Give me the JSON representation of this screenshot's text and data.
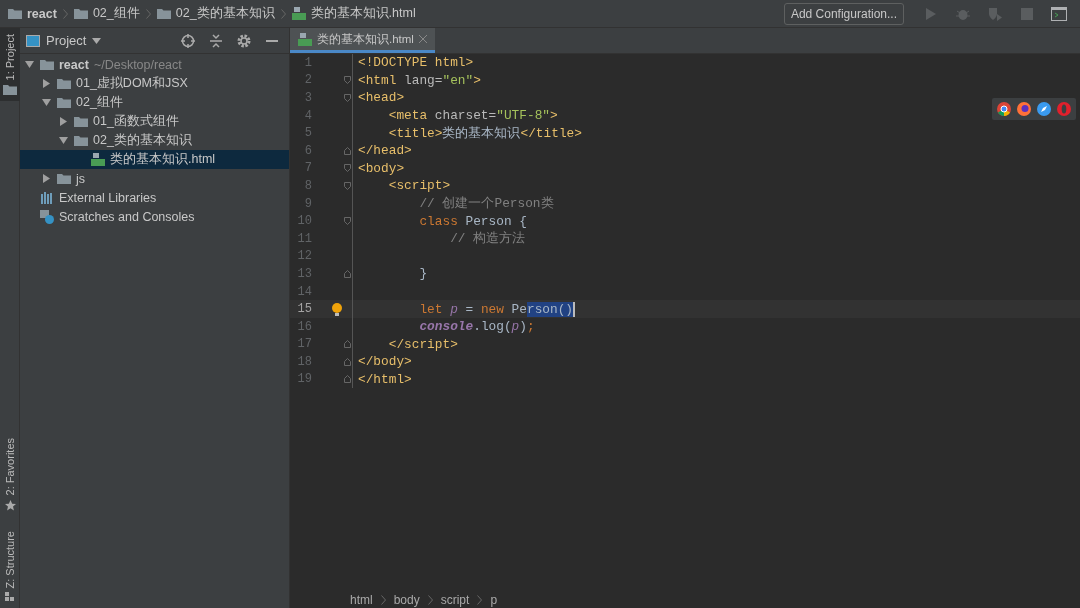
{
  "navbar": {
    "crumbs": [
      {
        "label": "react",
        "kind": "folder",
        "bold": true
      },
      {
        "label": "02_组件",
        "kind": "folder",
        "bold": false
      },
      {
        "label": "02_类的基本知识",
        "kind": "folder",
        "bold": false
      },
      {
        "label": "类的基本知识.html",
        "kind": "html",
        "bold": false
      }
    ],
    "config_button": "Add Configuration...",
    "run_actions": [
      {
        "kind": "run",
        "disabled": true
      },
      {
        "kind": "debug",
        "disabled": true
      },
      {
        "kind": "coverage",
        "disabled": true
      },
      {
        "kind": "stop",
        "disabled": true
      },
      {
        "kind": "terminal",
        "disabled": false
      }
    ]
  },
  "side_strip": {
    "top": [
      {
        "label": "1: Project",
        "kind": "folder",
        "selected": true
      }
    ],
    "bottom": [
      {
        "label": "2: Favorites",
        "kind": "star",
        "selected": false
      },
      {
        "label": "Z: Structure",
        "kind": "structure",
        "selected": false
      }
    ]
  },
  "project": {
    "title": "Project",
    "tree": [
      {
        "label": "react",
        "hint": "~/Desktop/react",
        "kind": "folder",
        "bold": true,
        "expanded": true,
        "selected": false,
        "children": [
          {
            "label": "01_虚拟DOM和JSX",
            "kind": "folder",
            "expanded": false,
            "selected": false
          },
          {
            "label": "02_组件",
            "kind": "folder",
            "expanded": true,
            "selected": false,
            "children": [
              {
                "label": "01_函数式组件",
                "kind": "folder",
                "expanded": false,
                "selected": false
              },
              {
                "label": "02_类的基本知识",
                "kind": "folder",
                "expanded": true,
                "selected": false,
                "children": [
                  {
                    "label": "类的基本知识.html",
                    "kind": "html",
                    "selected": true
                  }
                ]
              }
            ]
          },
          {
            "label": "js",
            "kind": "folder",
            "expanded": false,
            "selected": false
          }
        ]
      },
      {
        "label": "External Libraries",
        "kind": "libraries",
        "selected": false
      },
      {
        "label": "Scratches and Consoles",
        "kind": "scratches",
        "selected": false
      }
    ]
  },
  "editor": {
    "tabs": [
      {
        "label": "类的基本知识.html",
        "selected": true
      }
    ],
    "lines": [
      {
        "number": "1",
        "current": false,
        "fold_start": false,
        "fold_end": false,
        "tokens": [
          {
            "kind": "tag",
            "text": "<!DOCTYPE html>"
          }
        ]
      },
      {
        "number": "2",
        "current": false,
        "fold_start": true,
        "fold_end": false,
        "tokens": [
          {
            "kind": "tag",
            "text": "<html "
          },
          {
            "kind": "attr",
            "text": "lang="
          },
          {
            "kind": "str",
            "text": "\"en\""
          },
          {
            "kind": "tag",
            "text": ">"
          }
        ]
      },
      {
        "number": "3",
        "current": false,
        "fold_start": true,
        "fold_end": false,
        "tokens": [
          {
            "kind": "tag",
            "text": "<head>"
          }
        ]
      },
      {
        "number": "4",
        "current": false,
        "fold_start": false,
        "fold_end": false,
        "tokens": [
          {
            "kind": "tag",
            "text": "    <meta "
          },
          {
            "kind": "attr",
            "text": "charset="
          },
          {
            "kind": "str",
            "text": "\"UTF-8\""
          },
          {
            "kind": "tag",
            "text": ">"
          }
        ]
      },
      {
        "number": "5",
        "current": false,
        "fold_start": false,
        "fold_end": false,
        "tokens": [
          {
            "kind": "tag",
            "text": "    <title>"
          },
          {
            "kind": "plain",
            "text": "类的基本知识"
          },
          {
            "kind": "tag",
            "text": "</title>"
          }
        ]
      },
      {
        "number": "6",
        "current": false,
        "fold_start": false,
        "fold_end": true,
        "tokens": [
          {
            "kind": "tag",
            "text": "</head>"
          }
        ]
      },
      {
        "number": "7",
        "current": false,
        "fold_start": true,
        "fold_end": false,
        "tokens": [
          {
            "kind": "tag",
            "text": "<body>"
          }
        ]
      },
      {
        "number": "8",
        "current": false,
        "fold_start": true,
        "fold_end": false,
        "tokens": [
          {
            "kind": "tag",
            "text": "    <script>"
          }
        ]
      },
      {
        "number": "9",
        "current": false,
        "fold_start": false,
        "fold_end": false,
        "tokens": [
          {
            "kind": "comment",
            "text": "        // 创建一个Person类"
          }
        ]
      },
      {
        "number": "10",
        "current": false,
        "fold_start": true,
        "fold_end": false,
        "tokens": [
          {
            "kind": "keyword",
            "text": "        class "
          },
          {
            "kind": "plain",
            "text": "Person {"
          }
        ]
      },
      {
        "number": "11",
        "current": false,
        "fold_start": false,
        "fold_end": false,
        "tokens": [
          {
            "kind": "comment",
            "text": "            // 构造方法"
          }
        ]
      },
      {
        "number": "12",
        "current": false,
        "fold_start": false,
        "fold_end": false
      },
      {
        "number": "13",
        "current": false,
        "fold_start": false,
        "fold_end": true,
        "tokens": [
          {
            "kind": "plain",
            "text": "        }"
          }
        ]
      },
      {
        "number": "14",
        "current": false,
        "fold_start": false,
        "fold_end": false
      },
      {
        "number": "15",
        "current": true,
        "fold_start": false,
        "fold_end": false,
        "bulb": true,
        "tokens": [
          {
            "kind": "keyword",
            "text": "        let "
          },
          {
            "kind": "var",
            "text": "p"
          },
          {
            "kind": "plain",
            "text": " = "
          },
          {
            "kind": "keyword",
            "text": "new "
          },
          {
            "kind": "plain",
            "text": "Pe"
          },
          {
            "kind": "selection",
            "text": "rson()"
          }
        ]
      },
      {
        "number": "16",
        "current": false,
        "fold_start": false,
        "fold_end": false,
        "tokens": [
          {
            "kind": "call",
            "text": "        console"
          },
          {
            "kind": "plain",
            "text": ".log("
          },
          {
            "kind": "var",
            "text": "p"
          },
          {
            "kind": "plain",
            "text": ")"
          },
          {
            "kind": "keyword",
            "text": ";"
          }
        ]
      },
      {
        "number": "17",
        "current": false,
        "fold_start": false,
        "fold_end": true,
        "tokens": [
          {
            "kind": "tag",
            "text": "    </script>"
          }
        ]
      },
      {
        "number": "18",
        "current": false,
        "fold_start": false,
        "fold_end": true,
        "tokens": [
          {
            "kind": "tag",
            "text": "</body>"
          }
        ]
      },
      {
        "number": "19",
        "current": false,
        "fold_start": false,
        "fold_end": true,
        "tokens": [
          {
            "kind": "tag",
            "text": "</html>"
          }
        ]
      }
    ],
    "browsers": [
      {
        "kind": "chrome"
      },
      {
        "kind": "firefox"
      },
      {
        "kind": "safari"
      },
      {
        "kind": "opera"
      }
    ]
  },
  "status_path": [
    "html",
    "body",
    "script",
    "p"
  ]
}
